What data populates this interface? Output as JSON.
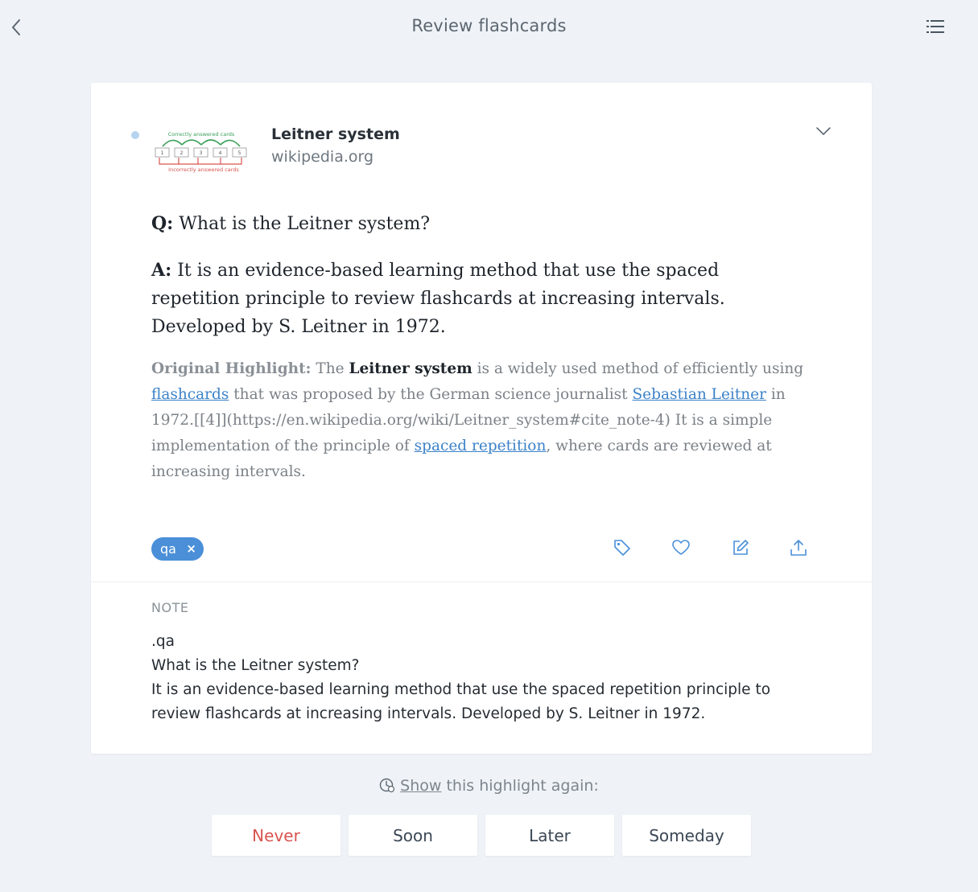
{
  "header": {
    "title": "Review flashcards"
  },
  "source": {
    "title": "Leitner system",
    "domain": "wikipedia.org"
  },
  "thumbnail": {
    "top_caption": "Correctly answered cards",
    "bottom_caption": "Incorrectly answered cards",
    "boxes": [
      "1",
      "2",
      "3",
      "4",
      "5"
    ]
  },
  "card": {
    "question_label": "Q:",
    "question": "What is the Leitner system?",
    "answer_label": "A:",
    "answer": "It is an evidence-based learning method that use the spaced repetition principle to review flashcards at increasing intervals. Developed by S. Leitner in 1972."
  },
  "highlight": {
    "label": "Original Highlight:",
    "t1": "The",
    "bold": "Leitner system",
    "t2": "is a widely used method of efficiently using",
    "link1": "flashcards",
    "t3": "that was proposed by the German science journalist",
    "link2": "Sebastian Leitner",
    "t4": "in 1972.[[4]](https://en.wikipedia.org/wiki/Leitner_system#cite_note-4) It is a simple implementation of the principle of",
    "link3": "spaced repetition",
    "t5": ", where cards are reviewed at increasing intervals."
  },
  "tags": [
    {
      "label": "qa",
      "remove": "×"
    }
  ],
  "note": {
    "label": "NOTE",
    "lines": [
      ".qa",
      "What is the Leitner system?",
      "It is an evidence-based learning method that use the spaced repetition principle to",
      "review flashcards at increasing intervals. Developed by S. Leitner in 1972."
    ]
  },
  "review": {
    "show_link": "Show",
    "prompt_rest": "this highlight again:",
    "choices": [
      "Never",
      "Soon",
      "Later",
      "Someday"
    ]
  },
  "colors": {
    "background": "#eff3f7",
    "accent": "#4a8fd8",
    "link": "#3c82c8",
    "never": "#d9534f",
    "icon": "#4a90d9"
  },
  "icons": {
    "back": "chevron-left-icon",
    "menu": "list-icon",
    "expand": "chevron-down-icon",
    "actions": [
      "tag-icon",
      "heart-icon",
      "edit-icon",
      "share-icon"
    ],
    "show_again": "clock-icon"
  }
}
